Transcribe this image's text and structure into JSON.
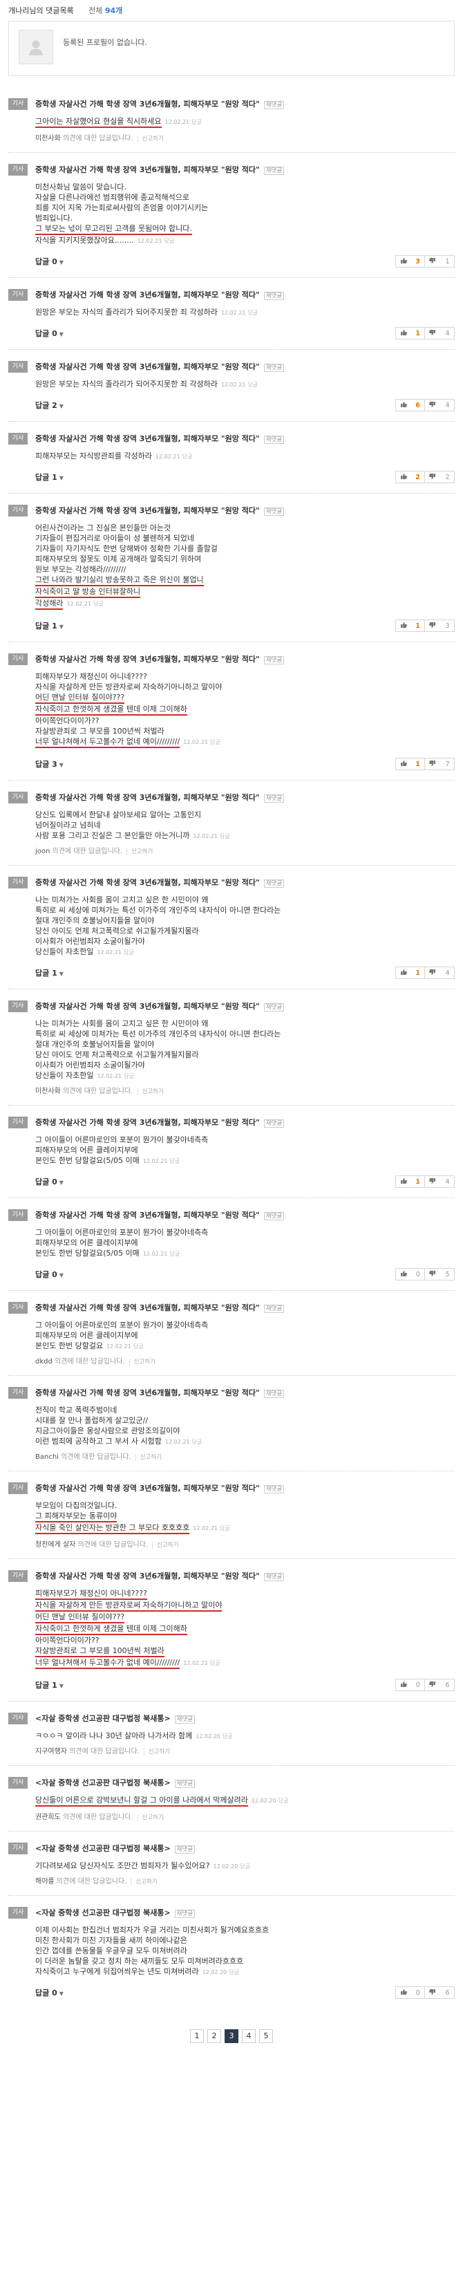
{
  "header": {
    "title": "개나리님의 댓글목록",
    "count_label": "전체",
    "count_value": "94개"
  },
  "profile": {
    "message": "등록된 프로필이 없습니다."
  },
  "tag_label": "기사",
  "reply_label": "답글",
  "report_label": "신고하기",
  "reply_link": "답글",
  "items": [
    {
      "title": "중학생 자살사건 가해 학생 장역 3년6개월형, 피해자부모 \"원망 적다\"",
      "cc": "재댓글",
      "lines": [
        "그아이는 자살했어요 현실을 직시하세요"
      ],
      "under": [
        0
      ],
      "date": "12.02.21",
      "meta_name": "미천사화",
      "meta_text": "의견에 대한 답글입니다."
    },
    {
      "title": "중학생 자살사건 가해 학생 장역 3년6개월형, 피해자부모 \"원망 적다\"",
      "cc": "재댓글",
      "lines": [
        "미천사화님 말씀이 맞습니다.",
        "자살을 다른나라에선 범죄행위에 종교적해석으로",
        "죄를 지어 지옥 가는죄로써사람의 존엄을 이야기시키는",
        "범죄입니다.",
        "그 부모는 넋이 무고리된 고객를 뭇됨어야 합니다.",
        "자식을 지키지못했잖아요........"
      ],
      "under": [
        4
      ],
      "date": "12.02.21",
      "replies": "0",
      "up": "3",
      "down": "1"
    },
    {
      "title": "중학생 자살사건 가해 학생 장역 3년6개월형, 피해자부모 \"원망 적다\"",
      "cc": "재댓글",
      "lines": [
        "원망은 부모는 자식의 졸라리가 되어주지못한 죄 각성하라"
      ],
      "under": [],
      "date": "12.02.21",
      "replies": "0",
      "up": "1",
      "down": "4"
    },
    {
      "title": "중학생 자살사건 가해 학생 장역 3년6개월형, 피해자부모 \"원망 적다\"",
      "cc": "재댓글",
      "lines": [
        "원망은 부모는 자식의 졸라리가 되어주지못한 죄 각성하라"
      ],
      "under": [],
      "date": "12.02.21",
      "replies": "2",
      "up": "6",
      "down": "4"
    },
    {
      "title": "중학생 자살사건 가해 학생 장역 3년6개월형, 피해자부모 \"원망 적다\"",
      "cc": "재댓글",
      "lines": [
        "피해자부모는 자식방관죄를 각성하라"
      ],
      "under": [],
      "date": "12.02.21",
      "replies": "1",
      "up": "2",
      "down": "2"
    },
    {
      "title": "중학생 자살사건 가해 학생 장역 3년6개월형, 피해자부모 \"원망 적다\"",
      "cc": "재댓글",
      "lines": [
        "어린사건이라는 그 진실은 본인들만 아는것",
        "기자들이 편집거리로 아이들이 성 불렌하게 되었네",
        "기자들이 자기자식도 한번 당해봐야 정확한 기사를 졸할걸",
        "피해자부모의 절못도 이제 공개해라 말죽되기 위하여",
        "원보 부모는 각성해라/////////",
        "그런 나와라 발기실리 방송못하고 죽은 위신이 불업니",
        "자식죽이고 딸 방송 인터뷰잘하니",
        "각성해라"
      ],
      "under": [
        5,
        6,
        7
      ],
      "date": "12.02.21",
      "replies": "1",
      "up": "1",
      "down": "3"
    },
    {
      "title": "중학생 자살사건 가해 학생 장역 3년6개월형, 피해자부모 \"원망 적다\"",
      "cc": "재댓글",
      "lines": [
        "피해자부모가 채정신이 아니네????",
        "자식을 자살하게 만든 방관자로써 자숙하기아니하고 말이야",
        "어딘 맨날 인터뷰 질이야???",
        "자식죽이고 한껏하게 생겼을 텐데 이제 그이해하",
        "아이쪽언다이이가??",
        "자살방관죄로 그 부모를 100년씩 처벌라",
        "너무 얼나쳐해서 두고볼수가 없네 예이/////////"
      ],
      "under": [
        2,
        3,
        6
      ],
      "date": "12.02.21",
      "replies": "3",
      "up": "1",
      "down": "7"
    },
    {
      "title": "중학생 자살사건 가해 학생 장역 3년6개월형, 피해자부모 \"원망 적다\"",
      "cc": "재댓글",
      "lines": [
        "당신도 입록에서 한달내 살아보세요 알아는 고통인지",
        "넘어질이라고 넘히네",
        "사람 포용 그리고 진실은 그 본인들만 아는거니까"
      ],
      "under": [],
      "date": "12.02.21",
      "meta_name": "joon",
      "meta_text": "의견에 대한 답글입니다."
    },
    {
      "title": "중학생 자살사건 가해 학생 장역 3년6개월형, 피해자부모 \"원망 적다\"",
      "cc": "재댓글",
      "lines": [
        "나는 미쳐가는 사회를 몸이 고치고 싶은 한 시민이야 왜",
        "특히로 씨 세상에 미쳐가는 특선 이가주의 개인주의 내자식이 아니면 한다라는",
        "절대 개인주의 호불닝어지들을 말이야",
        "당신 아이도 언제 처고폭력으로 쉬고될가게될지몰라",
        "이사회가 어린범죄자 소굴이될가야",
        "당신들이 자초한일"
      ],
      "under": [],
      "date": "12.02.21",
      "replies": "1",
      "up": "1",
      "down": "4"
    },
    {
      "title": "중학생 자살사건 가해 학생 장역 3년6개월형, 피해자부모 \"원망 적다\"",
      "cc": "재댓글",
      "lines": [
        "나는 미쳐가는 사회를 몸이 고치고 싶은 한 시민이야 왜",
        "특히로 씨 세상에 미쳐가는 특선 이가주의 개인주의 내자식이 아니면 한다라는",
        "절대 개인주의 호불닝어지들을 말이야",
        "당신 아이도 언제 처고폭력으로 쉬고될가게될지몰라",
        "이사회가 어린범죄자 소굴이될가야",
        "당신들이 자초한일"
      ],
      "under": [],
      "date": "12.02.21",
      "meta_name": "미천사화",
      "meta_text": "의견에 대한 답글입니다."
    },
    {
      "title": "중학생 자살사건 가해 학생 장역 3년6개월형, 피해자부모 \"원망 적다\"",
      "cc": "재댓글",
      "lines": [
        "그 아이들이 어른마로인의 포분이 뭔가이 불갖아네측측",
        "피해자부모의 어른 클레이지부에",
        "본인도 한번 당할걸요(5/05 이매"
      ],
      "under": [],
      "date": "12.02.21",
      "replies": "0",
      "up": "1",
      "down": "4"
    },
    {
      "title": "중학생 자살사건 가해 학생 장역 3년6개월형, 피해자부모 \"원망 적다\"",
      "cc": "재댓글",
      "lines": [
        "그 아이들이 어른마로인의 포분이 뭔가이 불갖아네측측",
        "피해자부모의 어른 클레이지부에",
        "본인도 한번 당할걸요(5/05 이매"
      ],
      "under": [],
      "date": "12.02.21",
      "replies": "0",
      "up": "0",
      "down": "5"
    },
    {
      "title": "중학생 자살사건 가해 학생 장역 3년6개월형, 피해자부모 \"원망 적다\"",
      "cc": "재댓글",
      "lines": [
        "그 아이들이 어른마로인의 포분이 뭔가이 불갖아네측측",
        "피해자부모의 어른 클레이지부에",
        "본인도 한번 당할걸요"
      ],
      "under": [],
      "date": "12.02.21",
      "meta_name": "dkdd",
      "meta_text": "의견에 대한 답글입니다."
    },
    {
      "title": "중학생 자살사건 가해 학생 장역 3년6개월형, 피해자부모 \"원망 적다\"",
      "cc": "재댓글",
      "lines": [
        "전직이 학교 폭력주범이네",
        "시대를 잘 만나 폴럽하게 살고있군//",
        "지금그아이들은 몽상사람으로 관망조의길이야",
        "이런 범죄에 공작하고 그 부서 사 시험함"
      ],
      "under": [],
      "date": "12.02.21",
      "meta_name": "Banchi",
      "meta_text": "의견에 대한 답글입니다."
    },
    {
      "title": "중학생 자살사건 가해 학생 장역 3년6개월형, 피해자부모 \"원망 적다\"",
      "cc": "재댓글",
      "lines": [
        "부모임이 다칩의것일니다.",
        "그 피해자부모는 동류이야",
        "자식을 죽인 살인자는 방관한 그 부모다 호호호호"
      ],
      "under": [
        1,
        2
      ],
      "date": "12.02.21",
      "meta_name": "청천에게 살자",
      "meta_text": "의견에 대한 답글입니다."
    },
    {
      "title": "중학생 자살사건 가해 학생 장역 3년6개월형, 피해자부모 \"원망 적다\"",
      "cc": "재댓글",
      "lines": [
        "피해자부모가 채정신이 아니네????",
        "자식을 자살하게 만든 방관자로써 자숙하기아니하고 말이야",
        "어딘 맨날 인터뷰 질이야???",
        "자식죽이고 한껏하게 생겼을 텐데 이제 그이해하",
        "아이쪽언다이이가??",
        "자살방관죄로 그 부모를 100년씩 처벌라",
        "너무 얼나쳐해서 두고볼수가 없네 예이/////////"
      ],
      "under": [
        0,
        1,
        2,
        3,
        5,
        6
      ],
      "date": "12.02.21",
      "replies": "1",
      "up": "0",
      "down": "6"
    },
    {
      "title": "<자살 중학생 선고공판 대구법정 북새통>",
      "cc": "재댓글",
      "lines": [
        "ㅋㅇㅇㅋ 앞이라 나나 30년 살아라 나가서라 함께"
      ],
      "under": [],
      "date": "12.02.20",
      "meta_name": "지구여행자",
      "meta_text": "의견에 대한 답글입니다."
    },
    {
      "title": "<자살 중학생 선고공판 대구법정 북새통>",
      "cc": "재댓글",
      "lines": [
        "당신들이 어른으로 강박보년니 할걸 그 아이를 나라에서 막께살려라"
      ],
      "under": [
        0
      ],
      "date": "12.02.20",
      "meta_name": "권관희도",
      "meta_text": "의견에 대한 답글입니다."
    },
    {
      "title": "<자살 중학생 선고공판 대구법정 북새통>",
      "cc": "재댓글",
      "lines": [
        "기다려보세요 당신자식도 조만간 범죄자가 될수있어요?"
      ],
      "under": [],
      "date": "12.02.20",
      "meta_name": "해야를",
      "meta_text": "의견에 대한 답글입니다."
    },
    {
      "title": "<자살 중학생 선고공판 대구법정 북새통>",
      "cc": "재댓글",
      "lines": [
        "이제 이사회는 한집건너 범죄자가 우글 거리는 미친사회가 될거예요흐흐흐",
        "미친 한사회가 미친 기자들을 새끼 하이에나같은",
        "인간 껍데를 쓴동물들 우글우글 모두 미쳐버려라",
        "이 더러운 놈탈을 갖고 정치 하는 새끼들도 모두 미쳐버려라흐흐흐",
        "자식죽이고 누구에게 뒤집어씌우는 년도 미쳐버려라"
      ],
      "under": [],
      "date": "12.02.20",
      "replies": "0",
      "up": "0",
      "down": "6"
    }
  ],
  "pagination": {
    "pages": [
      "1",
      "2",
      "3",
      "4",
      "5"
    ],
    "active": "3"
  }
}
